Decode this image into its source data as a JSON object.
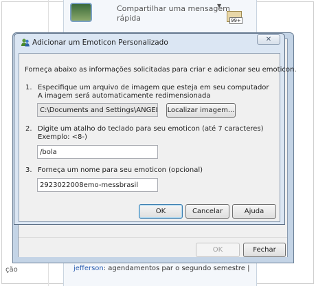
{
  "background": {
    "share_message": [
      "Compartilhar uma mensagem",
      "rápida"
    ],
    "mail_count": "99+",
    "left_text": "ção",
    "status_name": "jefferson",
    "status_text": ": agendamentos par o segundo semestre |"
  },
  "dialog": {
    "title": "Adicionar um Emoticon Personalizado",
    "close_glyph": "✕",
    "intro": "Forneça abaixo as informações solicitadas para criar e adicionar seu emoticon.",
    "step1": {
      "number": "1.",
      "line1": "Especifique um arquivo de imagem que esteja em seu computador",
      "line2": "A imagem será automaticamente redimensionada",
      "file_path": "C:\\Documents and Settings\\ANGELO",
      "browse_label": "Localizar imagem..."
    },
    "step2": {
      "number": "2.",
      "line1": "Digite um atalho do teclado para seu emoticon (até 7 caracteres)",
      "line2": "Exemplo: <8-)",
      "shortcut": "/bola"
    },
    "step3": {
      "number": "3.",
      "line1": "Forneça um nome para seu emoticon (opcional)",
      "name": "2923022008emo-messbrasil"
    },
    "buttons": {
      "ok": "OK",
      "cancel": "Cancelar",
      "help": "Ajuda"
    }
  },
  "parent_dialog": {
    "buttons": {
      "ok": "OK",
      "close": "Fechar"
    }
  },
  "colors": {
    "accent": "#3c7fb1",
    "link": "#2a5db0"
  }
}
